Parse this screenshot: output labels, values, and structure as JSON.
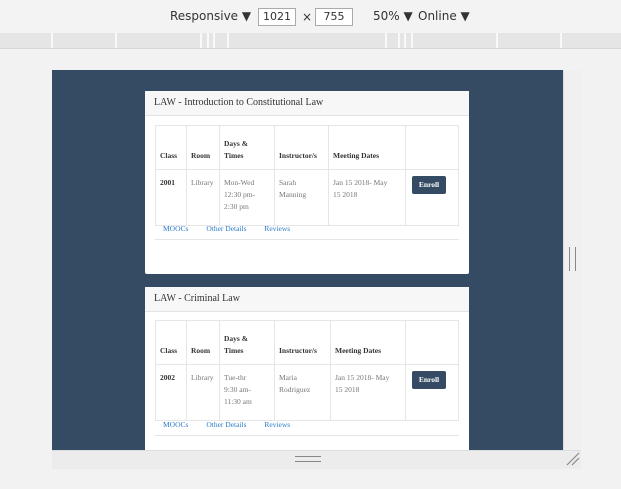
{
  "toolbar": {
    "device": "Responsive",
    "width": "1021",
    "times": "×",
    "height": "755",
    "zoom": "50%",
    "network": "Online"
  },
  "table_headers": {
    "class": "Class",
    "room": "Room",
    "days_times": [
      "Days &",
      "Times"
    ],
    "instructor": "Instructor/s",
    "meeting_dates": "Meeting Dates"
  },
  "courses": [
    {
      "title": "LAW - Introduction to Constitutional Law",
      "class": "2001",
      "room": "Library",
      "days_times": [
        "Mon-Wed",
        "12:30 pm-",
        "2:30 pm"
      ],
      "instructor": [
        "Sarah",
        "Manning"
      ],
      "meeting_dates": [
        "Jan 15 2018- May",
        "15 2018"
      ],
      "enroll": "Enroll",
      "links": [
        "MOOCs",
        "Other Details",
        "Reviews"
      ]
    },
    {
      "title": "LAW - Criminal Law",
      "class": "2002",
      "room": "Library",
      "days_times": [
        "Tue-thr",
        "9:30 am-",
        "11:30 am"
      ],
      "instructor": [
        "Maria",
        "Rodriguez"
      ],
      "meeting_dates": [
        "Jan 15 2018- May",
        "15 2018"
      ],
      "enroll": "Enroll",
      "links": [
        "MOOCs",
        "Other Details",
        "Reviews"
      ]
    }
  ]
}
